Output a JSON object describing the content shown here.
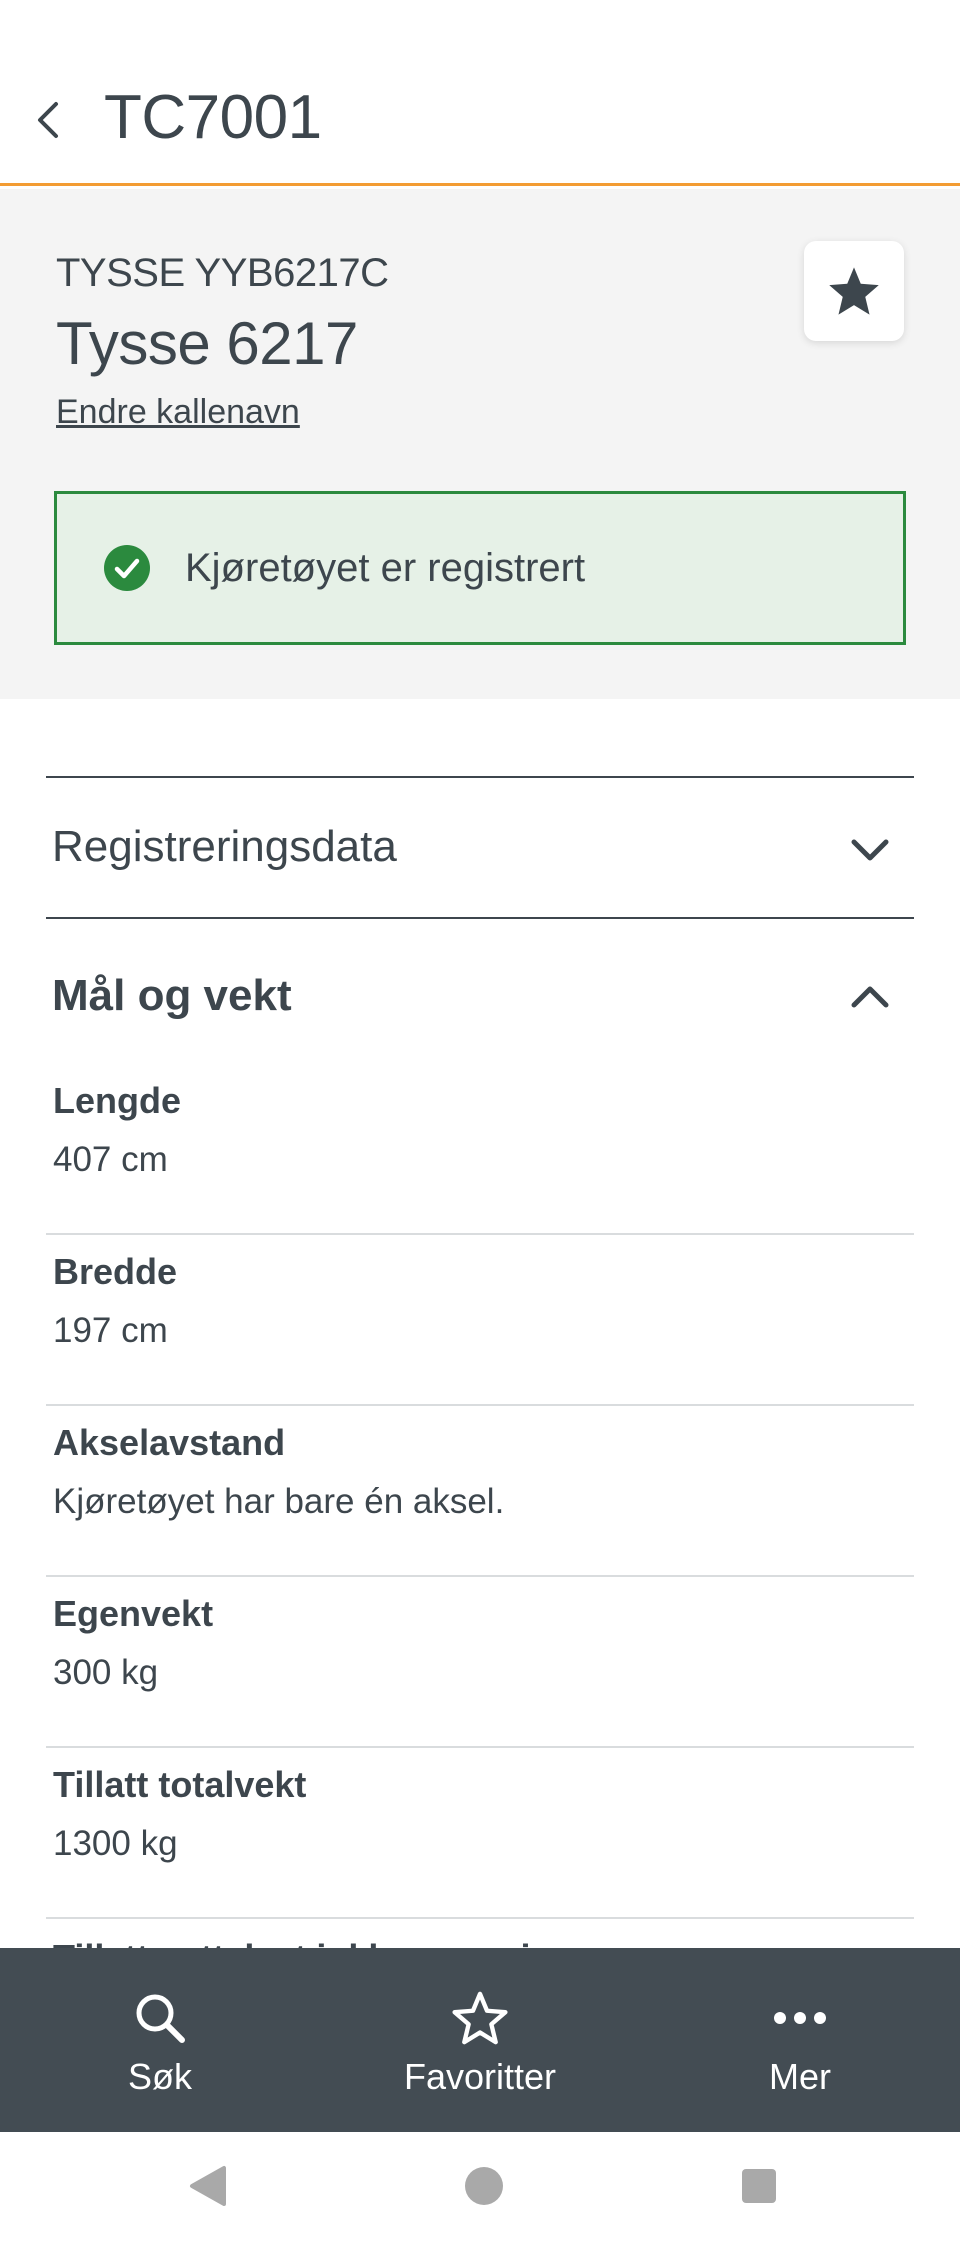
{
  "topbar": {
    "title": "TC7001",
    "back_icon": "chevron-left-icon",
    "accent_color": "#f39c33"
  },
  "vehicle": {
    "id_line": "TYSSE YYB6217C",
    "name": "Tysse 6217",
    "rename_link": "Endre kallenavn",
    "favorite_icon": "star-filled-icon"
  },
  "status": {
    "text": "Kjøretøyet er registrert",
    "icon": "check-circle-icon",
    "color": "#2b8a3e",
    "background": "#e6f1e7"
  },
  "sections": {
    "registration": {
      "label": "Registreringsdata",
      "expanded": false,
      "icon": "chevron-down-icon"
    },
    "dimensions": {
      "label": "Mål og vekt",
      "expanded": true,
      "icon": "chevron-up-icon"
    }
  },
  "properties": [
    {
      "label": "Lengde",
      "value": "407 cm"
    },
    {
      "label": "Bredde",
      "value": "197 cm"
    },
    {
      "label": "Akselavstand",
      "value": "Kjøretøyet har bare én aksel."
    },
    {
      "label": "Egenvekt",
      "value": "300 kg"
    },
    {
      "label": "Tillatt totalvekt",
      "value": "1300 kg"
    },
    {
      "label": "Tillatt nyttelast inkl. passasjerer",
      "value": ""
    }
  ],
  "tabbar": {
    "background": "#434c53",
    "tabs": [
      {
        "label": "Søk",
        "icon": "search-icon"
      },
      {
        "label": "Favoritter",
        "icon": "star-outline-icon"
      },
      {
        "label": "Mer",
        "icon": "more-dots-icon"
      }
    ]
  },
  "system_nav": {
    "buttons": [
      "back-triangle-icon",
      "home-circle-icon",
      "recents-square-icon"
    ]
  }
}
